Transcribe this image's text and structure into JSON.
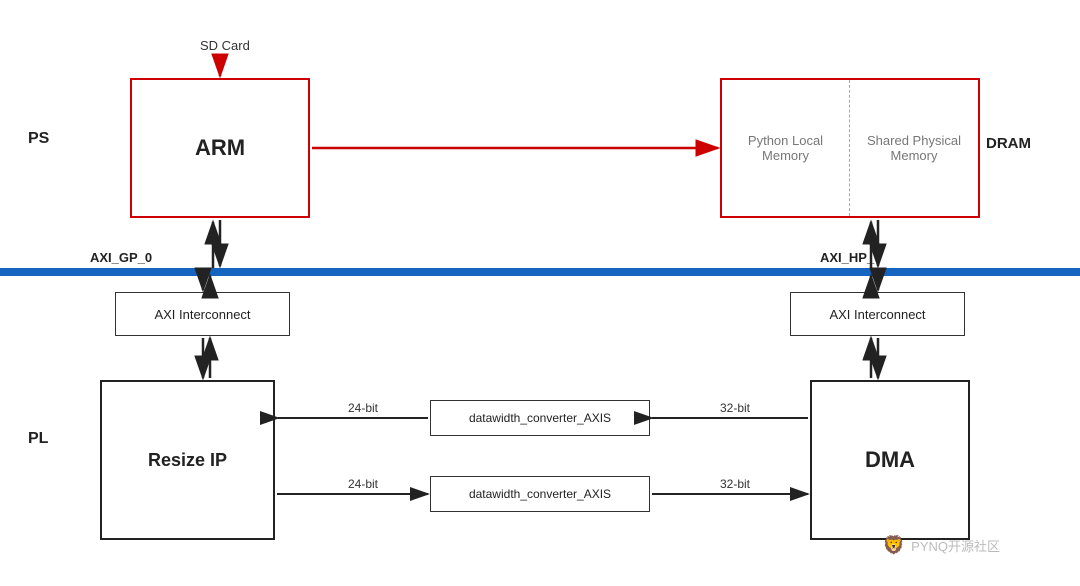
{
  "labels": {
    "ps": "PS",
    "pl": "PL",
    "sdcard": "SD Card",
    "arm": "ARM",
    "dram": "DRAM",
    "python_local_memory": "Python Local Memory",
    "shared_physical_memory": "Shared Physical Memory",
    "axi_gp_0": "AXI_GP_0",
    "axi_hp_0": "AXI_HP_0",
    "axi_interconnect": "AXI Interconnect",
    "resize_ip": "Resize IP",
    "dma": "DMA",
    "converter_axis": "datawidth_converter_AXIS",
    "bit_24": "24-bit",
    "bit_32_top": "32-bit",
    "bit_24_bottom": "24-bit",
    "bit_32_bottom": "32-bit",
    "watermark": "PYNQ开源社区"
  }
}
